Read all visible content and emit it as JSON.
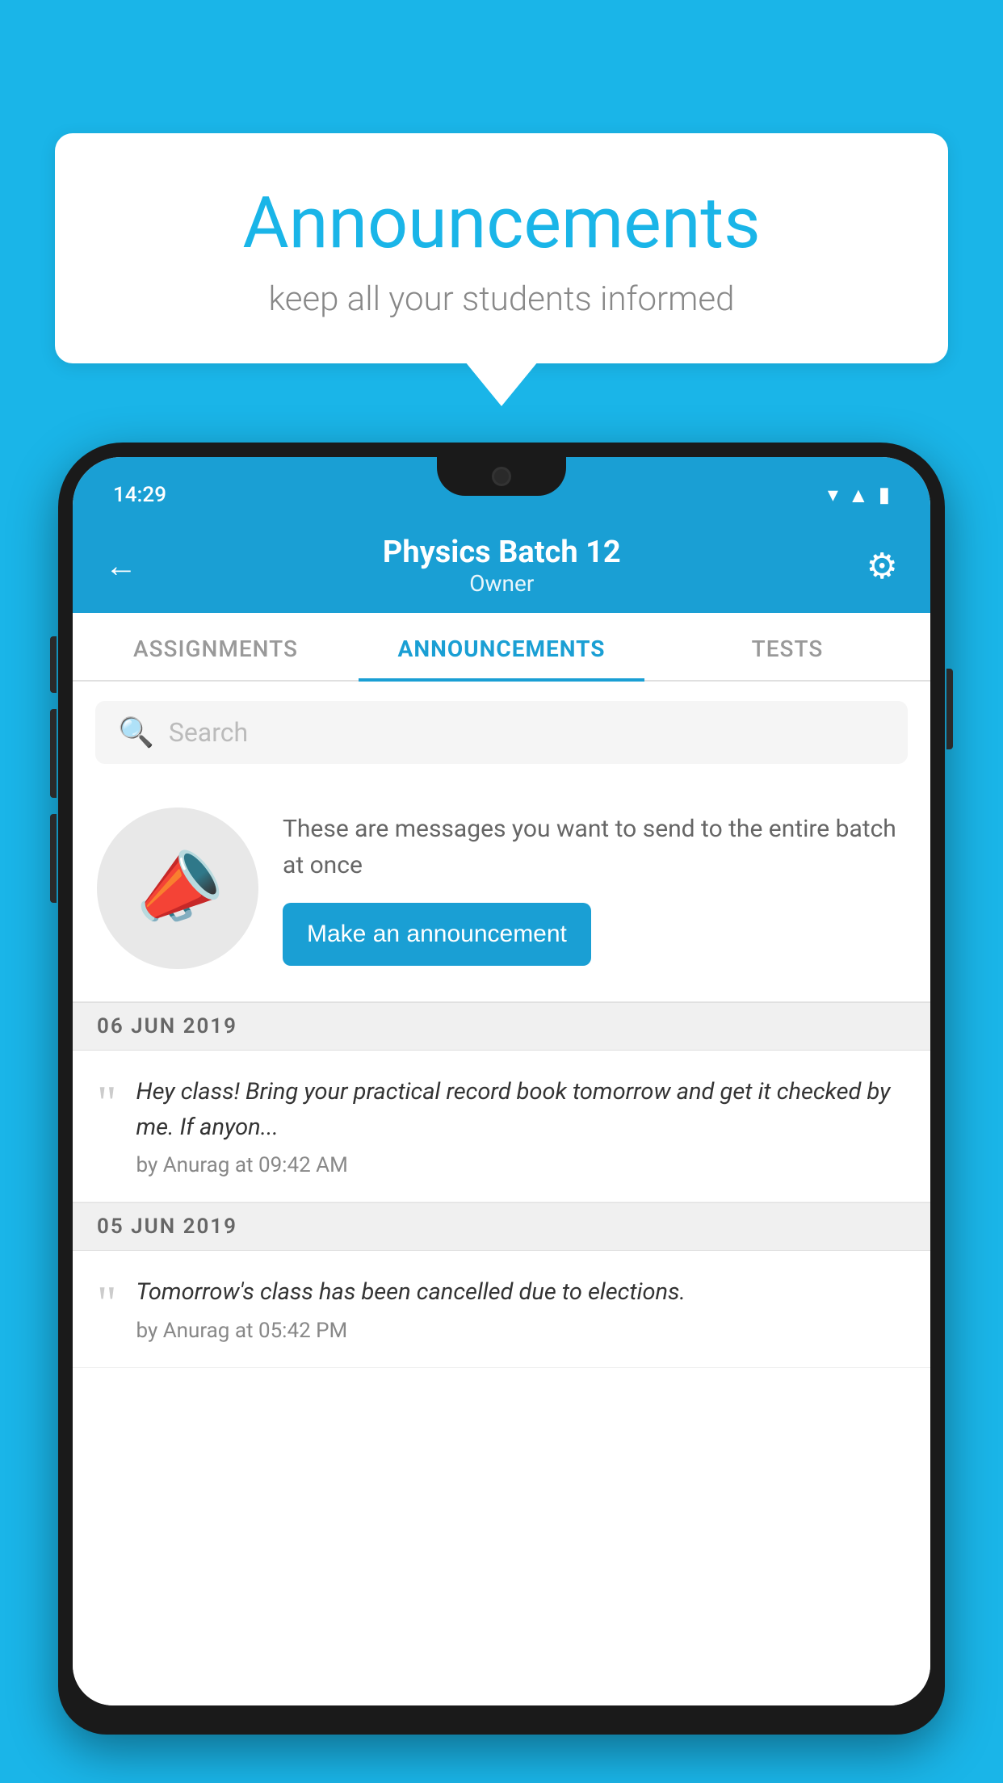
{
  "background_color": "#1ab5e8",
  "speech_bubble": {
    "title": "Announcements",
    "subtitle": "keep all your students informed"
  },
  "phone": {
    "status_bar": {
      "time": "14:29"
    },
    "header": {
      "title": "Physics Batch 12",
      "subtitle": "Owner",
      "back_label": "←",
      "gear_label": "⚙"
    },
    "tabs": [
      {
        "label": "ASSIGNMENTS",
        "active": false
      },
      {
        "label": "ANNOUNCEMENTS",
        "active": true
      },
      {
        "label": "TESTS",
        "active": false
      }
    ],
    "search": {
      "placeholder": "Search"
    },
    "promo": {
      "description": "These are messages you want to send to the entire batch at once",
      "button_label": "Make an announcement"
    },
    "announcements": [
      {
        "date": "06  JUN  2019",
        "text": "Hey class! Bring your practical record book tomorrow and get it checked by me. If anyon...",
        "meta": "by Anurag at 09:42 AM"
      },
      {
        "date": "05  JUN  2019",
        "text": "Tomorrow's class has been cancelled due to elections.",
        "meta": "by Anurag at 05:42 PM"
      }
    ]
  }
}
